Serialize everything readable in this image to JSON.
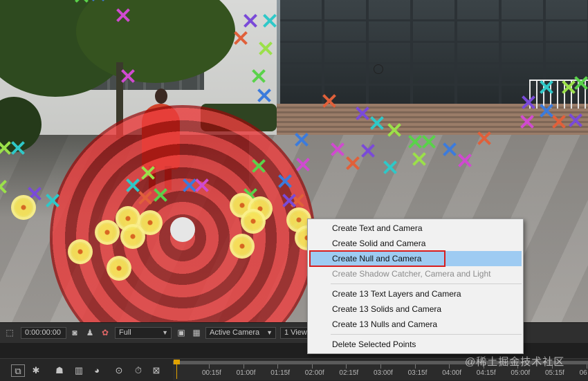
{
  "context_menu": {
    "items": [
      {
        "label": "Create Text and Camera",
        "enabled": true
      },
      {
        "label": "Create Solid and Camera",
        "enabled": true
      },
      {
        "label": "Create Null and Camera",
        "enabled": true,
        "hovered": true
      },
      {
        "label": "Create Shadow Catcher, Camera and Light",
        "enabled": false
      },
      {
        "label": "Create 13 Text Layers and Camera",
        "enabled": true
      },
      {
        "label": "Create 13 Solids and Camera",
        "enabled": true
      },
      {
        "label": "Create 13 Nulls and Camera",
        "enabled": true
      },
      {
        "label": "Delete Selected Points",
        "enabled": true
      }
    ]
  },
  "viewer_bar": {
    "timecode": "0:00:00:00",
    "resolution": "Full",
    "view": "Active Camera",
    "view_layout": "1 View"
  },
  "timeline": {
    "ruler_labels": [
      "00:15f",
      "01:00f",
      "01:15f",
      "02:00f",
      "02:15f",
      "03:00f",
      "03:15f",
      "04:00f",
      "04:15f",
      "05:00f",
      "05:15f",
      "06"
    ]
  },
  "watermark": "@稀土掘金技术社区",
  "colors": {
    "menu_hover": "#9ecbf2",
    "callout_border": "#d81d1d",
    "target_red": "#e63c3c",
    "track_point_yellow": "#f6e35a",
    "playhead": "#e0a200"
  }
}
